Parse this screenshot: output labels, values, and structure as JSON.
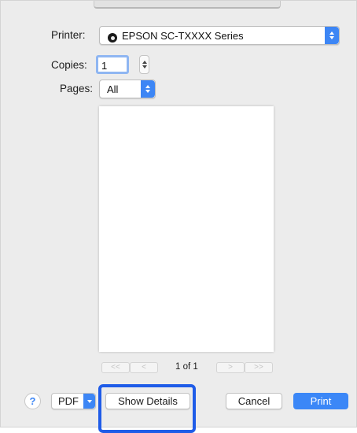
{
  "dialog": {
    "printer_label": "Printer:",
    "printer_value": "EPSON SC-TXXXX Series",
    "copies_label": "Copies:",
    "copies_value": "1",
    "pages_label": "Pages:",
    "pages_value": "All"
  },
  "preview": {
    "page_indicator": "1 of 1",
    "nav": {
      "first": "<<",
      "prev": "<",
      "next": ">",
      "last": ">>"
    }
  },
  "footer": {
    "help_label": "?",
    "pdf_label": "PDF",
    "show_details_label": "Show Details",
    "cancel_label": "Cancel",
    "print_label": "Print"
  },
  "colors": {
    "accent": "#3d86f5",
    "highlight_box": "#1f5ce8",
    "dialog_background": "#ececec"
  }
}
